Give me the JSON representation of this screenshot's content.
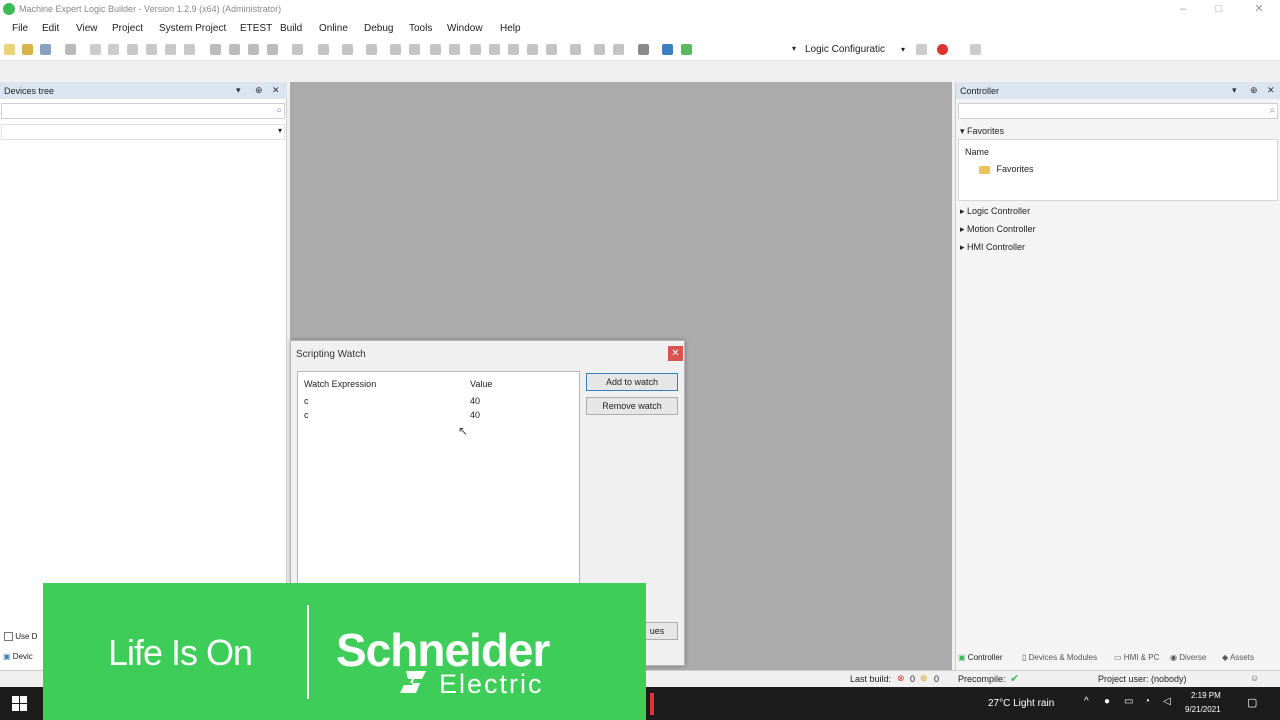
{
  "window": {
    "title": "Machine Expert Logic Builder - Version 1.2.9 (x64) (Administrator)",
    "minimize": "–",
    "maximize": "□",
    "close": "✕"
  },
  "menu": [
    "File",
    "Edit",
    "View",
    "Project",
    "System Project",
    "ETEST",
    "Build",
    "Online",
    "Debug",
    "Tools",
    "Window",
    "Help"
  ],
  "toolbar": {
    "logic_config": "Logic Configuratic"
  },
  "devices_tree": {
    "title": "Devices tree",
    "use_checkbox": "Use D",
    "bottom_tab": "Devic"
  },
  "controller_panel": {
    "title": "Controller",
    "favorites_section": "Favorites",
    "name_header": "Name",
    "favorites_folder": "Favorites",
    "sections": [
      "Logic Controller",
      "Motion Controller",
      "HMI Controller"
    ],
    "bottom_tabs": [
      "Controller",
      "Devices & Modules",
      "HMI & PC",
      "Diverse",
      "Assets"
    ]
  },
  "scripting_watch": {
    "title": "Scripting Watch",
    "col_expression": "Watch Expression",
    "col_value": "Value",
    "rows": [
      {
        "expression": "c",
        "value": "40"
      },
      {
        "expression": "c",
        "value": "40"
      }
    ],
    "add_button": "Add to watch",
    "remove_button": "Remove watch",
    "hidden_button_fragment": "ues"
  },
  "statusbar": {
    "last_build": "Last build:",
    "errors": "0",
    "warnings": "0",
    "precompile": "Precompile:",
    "project_user": "Project user: (nobody)"
  },
  "taskbar": {
    "weather": "27°C  Light rain",
    "time": "2:19 PM",
    "date": "9/21/2021"
  },
  "banner": {
    "tagline": "Life Is On",
    "brand": "Schneider",
    "brand_sub": "Electric"
  },
  "colors": {
    "brand_green": "#3dcd58",
    "panel_header": "#dbe5f1",
    "workspace_gray": "#ababab",
    "close_red": "#d9534f"
  }
}
